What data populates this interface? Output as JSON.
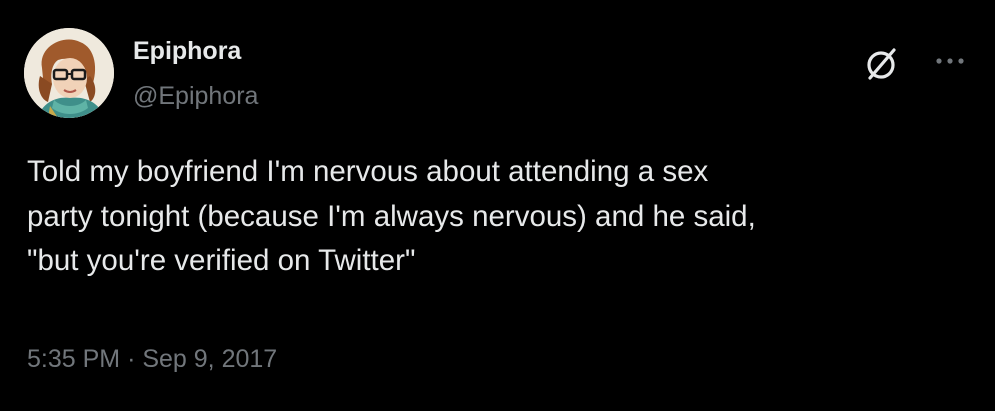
{
  "tweet": {
    "author": {
      "display_name": "Epiphora",
      "handle": "@Epiphora",
      "avatar_icon": "profile-avatar-illustration"
    },
    "text": "Told my boyfriend I'm nervous about attending a sex\nparty tonight (because I'm always nervous) and he said,\n\"but you're verified on Twitter\"",
    "time": "5:35 PM",
    "separator": "·",
    "date": "Sep 9, 2017",
    "actions": {
      "grok_icon": "grok-icon",
      "more_icon": "more-horizontal-icon"
    }
  },
  "colors": {
    "background": "#000000",
    "primary_text": "#e7e9ea",
    "secondary_text": "#71767b"
  }
}
